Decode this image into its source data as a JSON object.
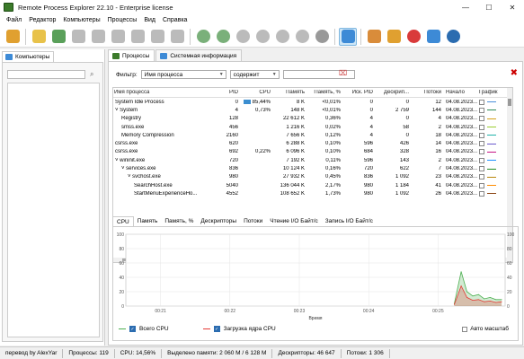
{
  "window": {
    "title": "Remote Process Explorer 22.10 - Enterprise license"
  },
  "window_controls": {
    "minimize": "—",
    "maximize": "☐",
    "close": "✕"
  },
  "menu": [
    "Файл",
    "Редактор",
    "Компьютеры",
    "Процессы",
    "Вид",
    "Справка"
  ],
  "left_panel": {
    "tab_label": "Компьютеры"
  },
  "tabs": [
    {
      "label": "Процессы",
      "color": "#3b7a2a"
    },
    {
      "label": "Системная информация",
      "color": "#3d8ad6"
    }
  ],
  "filter": {
    "label": "Фильтр:",
    "field": "Имя процесса",
    "condition": "содержит",
    "value": ""
  },
  "table": {
    "columns": [
      "Имя процесса",
      "PID",
      "CPU",
      "Память",
      "Память, %",
      "Иск. PID",
      "Дескрип...",
      "Потоки",
      "Начало",
      "График"
    ],
    "rows": [
      {
        "name": "System Idle Process",
        "pid": "0",
        "cpu": "85,44%",
        "mem": "8 K",
        "memp": "<0,01%",
        "ppid": "0",
        "hnd": "0",
        "thr": "12",
        "start": "04.08.2023...",
        "color": "#4a90d9",
        "indent": 0,
        "expander": ""
      },
      {
        "name": "System",
        "pid": "4",
        "cpu": "0,73%",
        "mem": "148 K",
        "memp": "<0,01%",
        "ppid": "0",
        "hnd": "2 759",
        "thr": "144",
        "start": "04.08.2023...",
        "color": "#2e8b57",
        "indent": 0,
        "expander": "˅"
      },
      {
        "name": "Registry",
        "pid": "128",
        "cpu": "",
        "mem": "22 612 K",
        "memp": "0,36%",
        "ppid": "4",
        "hnd": "0",
        "thr": "4",
        "start": "04.08.2023...",
        "color": "#d4a017",
        "indent": 1,
        "expander": ""
      },
      {
        "name": "smss.exe",
        "pid": "456",
        "cpu": "",
        "mem": "1 216 K",
        "memp": "0,02%",
        "ppid": "4",
        "hnd": "58",
        "thr": "2",
        "start": "04.08.2023...",
        "color": "#9acd32",
        "indent": 1,
        "expander": ""
      },
      {
        "name": "Memory Compression",
        "pid": "2160",
        "cpu": "",
        "mem": "7 656 K",
        "memp": "0,12%",
        "ppid": "4",
        "hnd": "0",
        "thr": "18",
        "start": "04.08.2023...",
        "color": "#20b2aa",
        "indent": 1,
        "expander": ""
      },
      {
        "name": "csrss.exe",
        "pid": "620",
        "cpu": "",
        "mem": "6 288 K",
        "memp": "0,10%",
        "ppid": "596",
        "hnd": "426",
        "thr": "14",
        "start": "04.08.2023...",
        "color": "#6a5acd",
        "indent": 0,
        "expander": ""
      },
      {
        "name": "csrss.exe",
        "pid": "692",
        "cpu": "0,22%",
        "mem": "6 096 K",
        "memp": "0,10%",
        "ppid": "684",
        "hnd": "328",
        "thr": "16",
        "start": "04.08.2023...",
        "color": "#c71585",
        "indent": 0,
        "expander": ""
      },
      {
        "name": "wininit.exe",
        "pid": "720",
        "cpu": "",
        "mem": "7 192 K",
        "memp": "0,11%",
        "ppid": "596",
        "hnd": "143",
        "thr": "2",
        "start": "04.08.2023...",
        "color": "#1e90ff",
        "indent": 0,
        "expander": "˅"
      },
      {
        "name": "services.exe",
        "pid": "836",
        "cpu": "",
        "mem": "10 124 K",
        "memp": "0,16%",
        "ppid": "720",
        "hnd": "622",
        "thr": "7",
        "start": "04.08.2023...",
        "color": "#228b22",
        "indent": 1,
        "expander": "˅"
      },
      {
        "name": "svchost.exe",
        "pid": "980",
        "cpu": "",
        "mem": "27 932 K",
        "memp": "0,45%",
        "ppid": "836",
        "hnd": "1 092",
        "thr": "23",
        "start": "04.08.2023...",
        "color": "#b8860b",
        "indent": 2,
        "expander": "˅"
      },
      {
        "name": "SearchHost.exe",
        "pid": "5040",
        "cpu": "",
        "mem": "136 044 K",
        "memp": "2,17%",
        "ppid": "980",
        "hnd": "1 184",
        "thr": "41",
        "start": "04.08.2023...",
        "color": "#ff8c00",
        "indent": 3,
        "expander": ""
      },
      {
        "name": "StartMenuExperienceHo...",
        "pid": "4552",
        "cpu": "",
        "mem": "108 652 K",
        "memp": "1,73%",
        "ppid": "980",
        "hnd": "1 092",
        "thr": "26",
        "start": "04.08.2023...",
        "color": "#8b4513",
        "indent": 3,
        "expander": ""
      }
    ]
  },
  "graph_tabs": [
    "CPU",
    "Память",
    "Память, %",
    "Дескрипторы",
    "Потоки",
    "Чтение I/O Байт/с",
    "Запись I/O Байт/с"
  ],
  "chart_data": {
    "type": "line",
    "xlabel": "Время",
    "x_ticks": [
      "00:21",
      "00:22",
      "00:23",
      "00:24",
      "00:25"
    ],
    "ylim": [
      0,
      100
    ],
    "y_ticks": [
      0,
      20,
      40,
      60,
      80,
      100
    ],
    "series": [
      {
        "name": "Всего CPU",
        "color": "#4caf50",
        "values": [
          {
            "t": "00:25:14",
            "v": 3
          },
          {
            "t": "00:25:20",
            "v": 48
          },
          {
            "t": "00:25:25",
            "v": 20
          },
          {
            "t": "00:25:30",
            "v": 14
          },
          {
            "t": "00:25:35",
            "v": 16
          },
          {
            "t": "00:25:40",
            "v": 10
          },
          {
            "t": "00:25:45",
            "v": 12
          },
          {
            "t": "00:25:50",
            "v": 9
          },
          {
            "t": "00:25:55",
            "v": 9
          }
        ]
      },
      {
        "name": "Загрузка ядра CPU",
        "color": "#e53935",
        "values": [
          {
            "t": "00:25:14",
            "v": 2
          },
          {
            "t": "00:25:20",
            "v": 28
          },
          {
            "t": "00:25:25",
            "v": 12
          },
          {
            "t": "00:25:30",
            "v": 8
          },
          {
            "t": "00:25:35",
            "v": 9
          },
          {
            "t": "00:25:40",
            "v": 6
          },
          {
            "t": "00:25:45",
            "v": 7
          },
          {
            "t": "00:25:50",
            "v": 5
          },
          {
            "t": "00:25:55",
            "v": 6
          }
        ]
      }
    ],
    "legend_position": "bottom-left",
    "grid": true
  },
  "auto_scale_label": "Авто масштаб",
  "status": {
    "author": "перевод by AlexYar",
    "processes": "Процессы: 119",
    "cpu": "CPU: 14,56%",
    "memory": "Выделено памяти: 2 060 M / 6 128 M",
    "handles": "Дескрипторы: 46 647",
    "threads": "Потоки: 1 306"
  },
  "toolbar_icons": [
    {
      "name": "connect-icon",
      "color": "#e0a030"
    },
    {
      "name": "folder-add-icon",
      "color": "#e8c24a"
    },
    {
      "name": "computer-add-icon",
      "color": "#5aa05a"
    },
    {
      "name": "computer-remove-icon",
      "color": "#bbbbbb"
    },
    {
      "name": "computer-edit-icon",
      "color": "#bbbbbb"
    },
    {
      "name": "run-icon",
      "color": "#bbbbbb"
    },
    {
      "name": "kill-icon",
      "color": "#bbbbbb"
    },
    {
      "name": "kill-tree-icon",
      "color": "#bbbbbb"
    },
    {
      "name": "restart-icon",
      "color": "#bbbbbb"
    },
    {
      "name": "services-icon",
      "color": "#7ab07a"
    },
    {
      "name": "gear-add-icon",
      "color": "#7ab07a"
    },
    {
      "name": "gear-icon",
      "color": "#bbbbbb"
    },
    {
      "name": "gear-2-icon",
      "color": "#bbbbbb"
    },
    {
      "name": "gear-3-icon",
      "color": "#bbbbbb"
    },
    {
      "name": "gear-4-icon",
      "color": "#bbbbbb"
    },
    {
      "name": "gear-5-icon",
      "color": "#999999"
    },
    {
      "name": "filter-icon",
      "color": "#3d8ad6"
    },
    {
      "name": "users-icon",
      "color": "#d98c3a"
    },
    {
      "name": "tools-icon",
      "color": "#e0a030"
    },
    {
      "name": "help-icon",
      "color": "#d93a3a"
    },
    {
      "name": "home-icon",
      "color": "#3d8ad6"
    },
    {
      "name": "info-icon",
      "color": "#2b6cb0"
    }
  ]
}
